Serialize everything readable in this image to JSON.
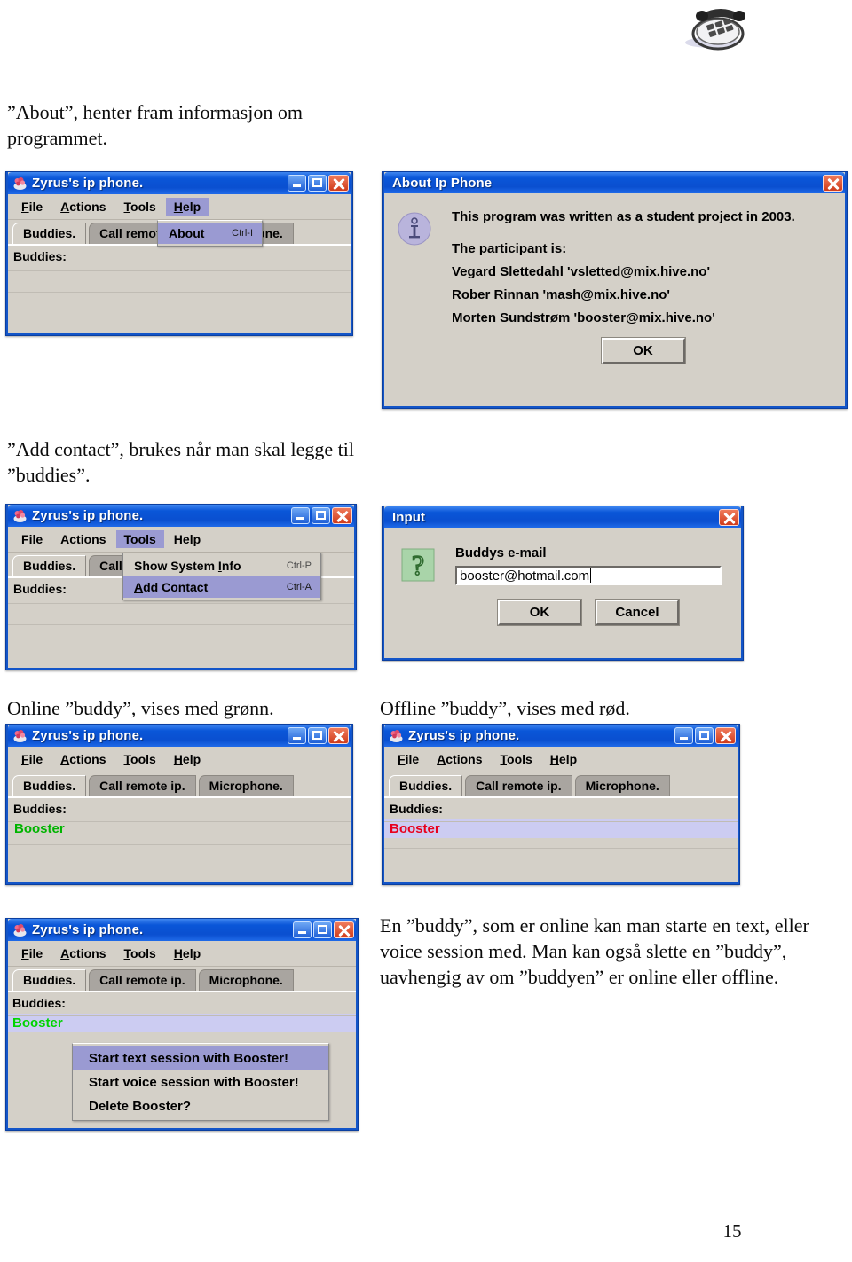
{
  "header": {
    "logo_icon": "telephone-icon"
  },
  "page_number": "15",
  "paragraphs": {
    "about_desc": "”About”, henter fram informasjon om programmet.",
    "add_contact_desc": "”Add contact”, brukes når man skal legge til ”buddies”.",
    "online_caption": "Online ”buddy”, vises med grønn.",
    "offline_caption": "Offline ”buddy”, vises med rød.",
    "buddy_actions_desc": "En ”buddy”, som er online kan man starte en text, eller voice session med. Man kan også slette en ”buddy”, uavhengig av om ”buddyen” er online eller offline."
  },
  "app": {
    "title": "Zyrus's ip phone.",
    "icon": "app-icon",
    "window_buttons": {
      "minimize": "minimize-button",
      "maximize": "maximize-button",
      "close": "close-button"
    },
    "menus": [
      {
        "label": "File",
        "mnemonic": "F"
      },
      {
        "label": "Actions",
        "mnemonic": "A"
      },
      {
        "label": "Tools",
        "mnemonic": "T"
      },
      {
        "label": "Help",
        "mnemonic": "H"
      }
    ],
    "tabs": [
      {
        "label": "Buddies.",
        "active": true
      },
      {
        "label": "Call remote ip.",
        "active": false
      },
      {
        "label": "Microphone.",
        "active": false
      }
    ],
    "buddies_label": "Buddies:",
    "buddy_name": "Booster",
    "online_color": "#00b400",
    "offline_color": "#e8001c",
    "selected_row_color": "#ccccf2"
  },
  "help_menu": {
    "open_menu": "Help",
    "items": [
      {
        "label": "About",
        "mnemonic": "A",
        "accelerator": "Ctrl-I",
        "highlighted": true
      }
    ]
  },
  "tools_menu": {
    "open_menu": "Tools",
    "items": [
      {
        "label": "Show System Info",
        "mnemonic": "I",
        "accelerator": "Ctrl-P",
        "highlighted": false
      },
      {
        "label": "Add Contact",
        "mnemonic": "A",
        "accelerator": "Ctrl-A",
        "highlighted": true
      }
    ]
  },
  "about_dialog": {
    "title": "About Ip Phone",
    "icon": "info-icon",
    "close_button": "close-button",
    "line1": "This program was written as a student project in 2003.",
    "line2": "The participant is:",
    "participants": [
      "Vegard Slettedahl 'vsletted@mix.hive.no'",
      "Rober Rinnan 'mash@mix.hive.no'",
      "Morten Sundstrøm 'booster@mix.hive.no'"
    ],
    "ok_label": "OK"
  },
  "input_dialog": {
    "title": "Input",
    "icon": "question-icon",
    "close_button": "close-button",
    "field_label": "Buddys e-mail",
    "field_value": "booster@hotmail.com",
    "field_placeholder": "",
    "ok_label": "OK",
    "cancel_label": "Cancel"
  },
  "context_menu": {
    "items": [
      {
        "label": "Start text session with Booster!",
        "highlighted": true
      },
      {
        "label": "Start voice session with Booster!",
        "highlighted": false
      },
      {
        "label": "Delete Booster?",
        "highlighted": false
      }
    ]
  }
}
